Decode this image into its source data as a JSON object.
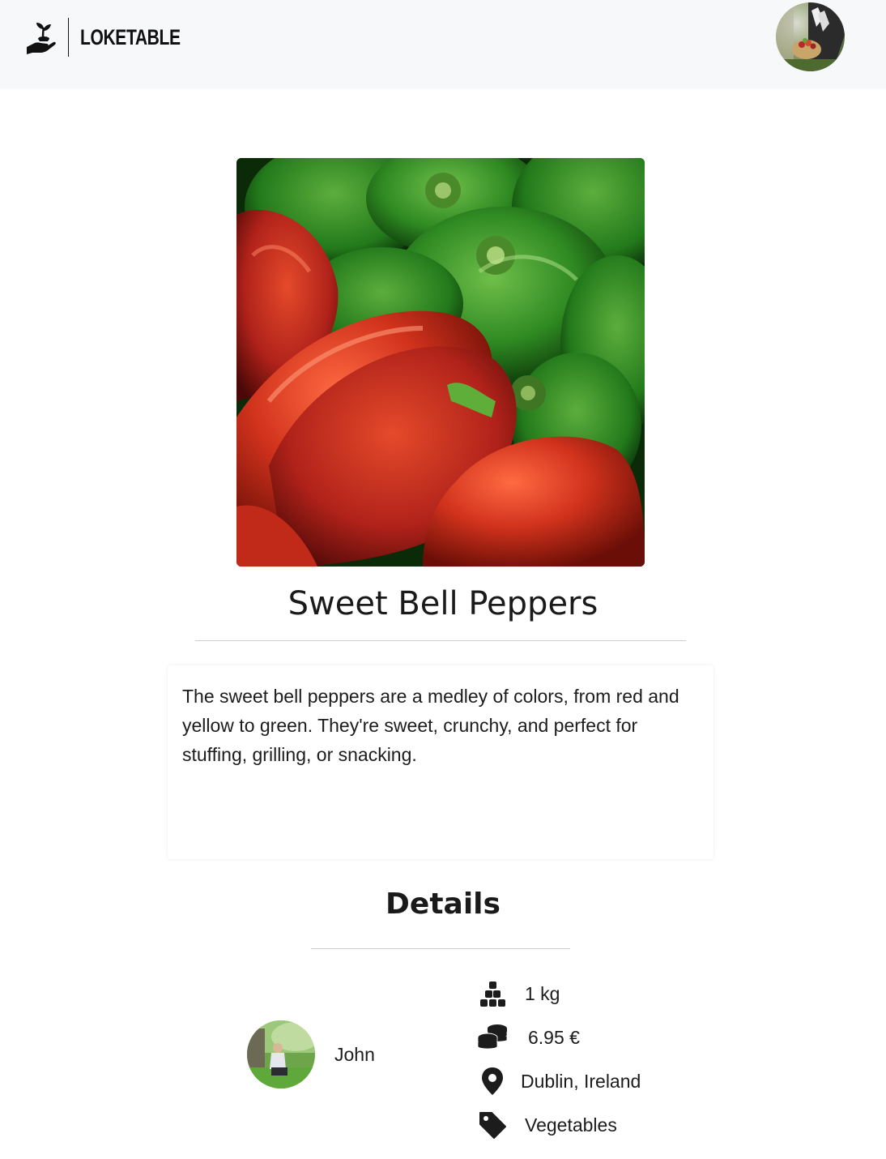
{
  "header": {
    "brand_name": "LOKETABLE",
    "logo_icon": "hand-sprout-icon",
    "user_avatar_icon": "user-avatar"
  },
  "product": {
    "title": "Sweet Bell Peppers",
    "image_icon": "peppers-photo",
    "description": "The sweet bell peppers are a medley of colors, from red and yellow to green. They're sweet, crunchy, and perfect for stuffing, grilling, or snacking."
  },
  "details": {
    "heading": "Details",
    "seller_name": "John",
    "quantity": "1 kg",
    "price": "6.95 €",
    "location": "Dublin, Ireland",
    "category": "Vegetables"
  },
  "colors": {
    "header_bg": "#f7f8fa",
    "text": "#1c1c1c",
    "divider": "#cfcfcf"
  }
}
